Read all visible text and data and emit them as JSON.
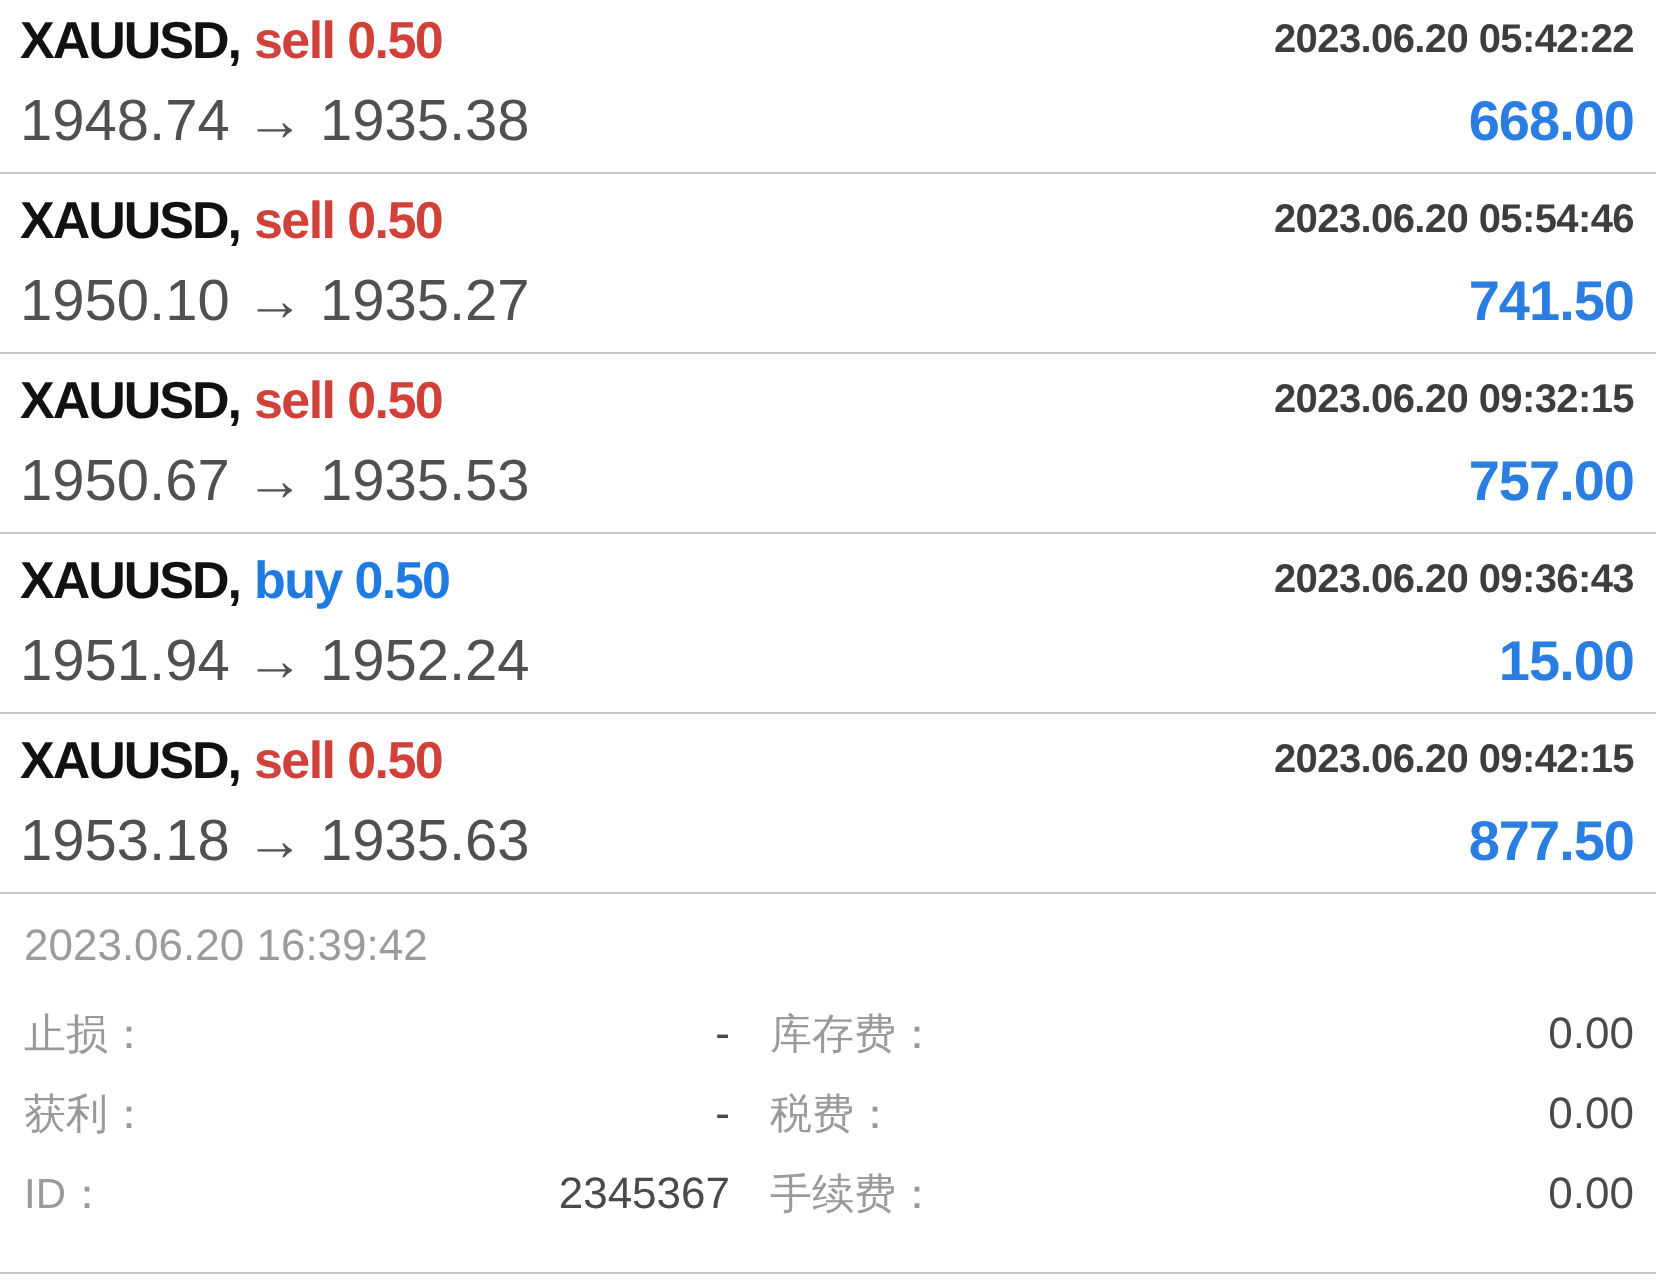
{
  "trades": [
    {
      "symbol": "XAUUSD,",
      "order": "sell 0.50",
      "kind": "sell",
      "time": "2023.06.20 05:42:22",
      "prices": "1948.74 → 1935.38",
      "profit": "668.00"
    },
    {
      "symbol": "XAUUSD,",
      "order": "sell 0.50",
      "kind": "sell",
      "time": "2023.06.20 05:54:46",
      "prices": "1950.10 → 1935.27",
      "profit": "741.50"
    },
    {
      "symbol": "XAUUSD,",
      "order": "sell 0.50",
      "kind": "sell",
      "time": "2023.06.20 09:32:15",
      "prices": "1950.67 → 1935.53",
      "profit": "757.00"
    },
    {
      "symbol": "XAUUSD,",
      "order": "buy 0.50",
      "kind": "buy",
      "time": "2023.06.20 09:36:43",
      "prices": "1951.94 → 1952.24",
      "profit": "15.00"
    },
    {
      "symbol": "XAUUSD,",
      "order": "sell 0.50",
      "kind": "sell",
      "time": "2023.06.20 09:42:15",
      "prices": "1953.18 → 1935.63",
      "profit": "877.50"
    }
  ],
  "summary": {
    "time": "2023.06.20 16:39:42",
    "details": [
      {
        "label": "止损：",
        "value": "-"
      },
      {
        "label": "库存费：",
        "value": "0.00"
      },
      {
        "label": "获利：",
        "value": "-"
      },
      {
        "label": "税费：",
        "value": "0.00"
      },
      {
        "label": "ID：",
        "value": "2345367"
      },
      {
        "label": "手续费：",
        "value": "0.00"
      }
    ]
  }
}
